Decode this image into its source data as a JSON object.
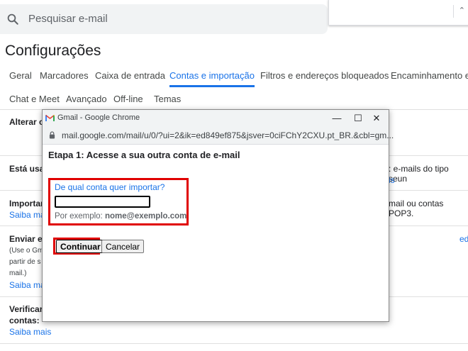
{
  "search": {
    "placeholder": "Pesquisar e-mail"
  },
  "page": {
    "title": "Configurações"
  },
  "tabs_row1": [
    {
      "label": "Geral"
    },
    {
      "label": "Marcadores"
    },
    {
      "label": "Caixa de entrada"
    },
    {
      "label": "Contas e importação",
      "active": true
    },
    {
      "label": "Filtros e endereços bloqueados"
    },
    {
      "label": "Encaminhamento e P"
    }
  ],
  "tabs_row2": [
    {
      "label": "Chat e Meet"
    },
    {
      "label": "Avançado"
    },
    {
      "label": "Off-line"
    },
    {
      "label": "Temas"
    }
  ],
  "background": {
    "alterar": "Alterar c",
    "esta_usando": "Está usar",
    "esta_usando_right": ": e-mails do tipo seun",
    "esta_usando_right_link": "is",
    "importar": "Importar",
    "importar_right": "mail ou contas POP3.",
    "saiba_mais_1": "Saiba mai",
    "enviar": "Enviar e-",
    "enviar_small_1": "(Use o Gm",
    "enviar_small_2": "partir de s",
    "enviar_small_3": "mail.)",
    "enviar_edit": "ed",
    "saiba_mais_2": "Saiba mai",
    "verificar": "Verificar",
    "contas": "contas:",
    "saiba_mais_3": "Saiba mais"
  },
  "chrome": {
    "title": "Gmail - Google Chrome",
    "url": "mail.google.com/mail/u/0/?ui=2&ik=ed849ef875&jsver=0ciFChY2CXU.pt_BR.&cbl=gm...",
    "minimize": "—",
    "maximize": "☐",
    "close": "✕"
  },
  "dialog": {
    "step_title": "Etapa 1: Acesse a sua outra conta de e-mail",
    "question": "De qual conta quer importar?",
    "email_value": "",
    "example_prefix": "Por exemplo: ",
    "example_value": "nome@exemplo.com",
    "continue_label": "Continuar",
    "cancel_label": "Cancelar"
  },
  "colors": {
    "accent": "#1a73e8",
    "highlight": "#e00000"
  }
}
